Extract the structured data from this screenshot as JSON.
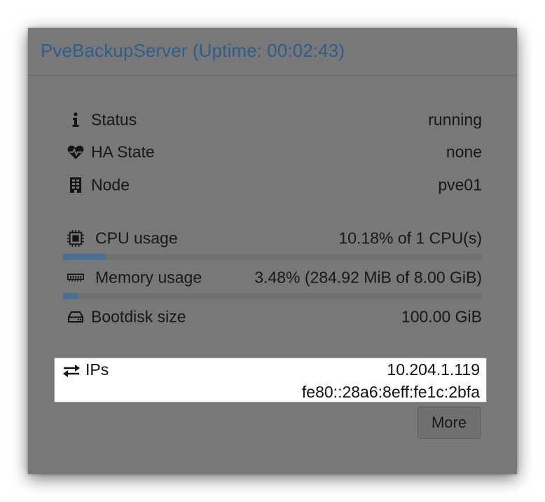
{
  "panel": {
    "title": "PveBackupServer (Uptime: 00:02:43)"
  },
  "colors": {
    "panel_bg": "#787878",
    "title": "#2e5f8c",
    "bar_fill": "#4a6f91",
    "ip_box_bg": "#ffffff"
  },
  "info": {
    "status": {
      "icon": "info-icon",
      "label": "Status",
      "value": "running"
    },
    "ha_state": {
      "icon": "heartbeat-icon",
      "label": "HA State",
      "value": "none"
    },
    "node": {
      "icon": "server-icon",
      "label": "Node",
      "value": "pve01"
    }
  },
  "usage": {
    "cpu": {
      "icon": "cpu-icon",
      "label": "CPU usage",
      "value": "10.18% of 1 CPU(s)",
      "fraction": 0.1018
    },
    "memory": {
      "icon": "memory-icon",
      "label": "Memory usage",
      "value": "3.48% (284.92 MiB of 8.00 GiB)",
      "fraction": 0.0348
    },
    "bootdisk": {
      "icon": "hdd-icon",
      "label": "Bootdisk size",
      "value": "100.00 GiB"
    }
  },
  "ips": {
    "icon": "exchange-icon",
    "label": "IPs",
    "addresses": [
      "10.204.1.119",
      "fe80::28a6:8eff:fe1c:2bfa"
    ]
  },
  "more_button": {
    "label": "More"
  }
}
